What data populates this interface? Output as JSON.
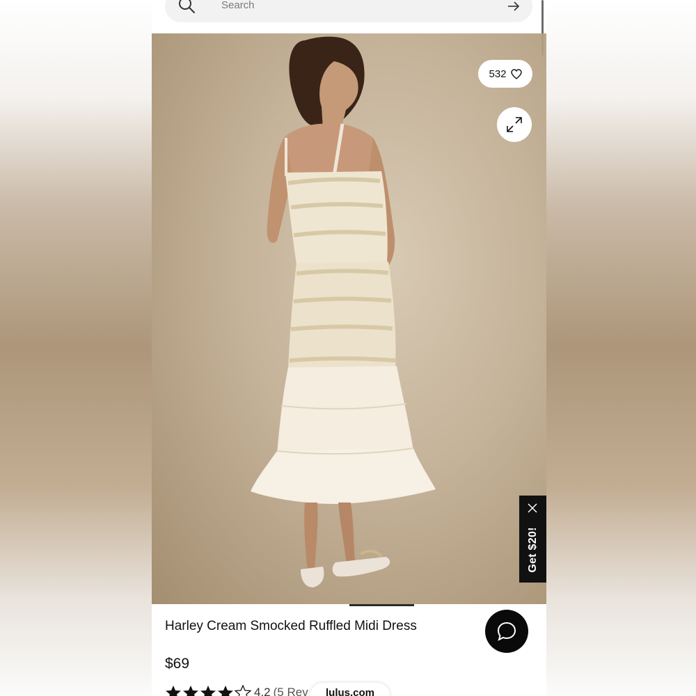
{
  "search": {
    "placeholder": "Search",
    "icon": "search-icon",
    "submit_icon": "arrow-right-icon"
  },
  "product_image": {
    "alt": "Model wearing cream smocked ruffled midi dress, back view"
  },
  "favorites": {
    "count": "532",
    "icon": "heart-icon"
  },
  "expand": {
    "icon": "expand-icon"
  },
  "promo": {
    "label": "Get $20!",
    "close_icon": "close-icon"
  },
  "product": {
    "title": "Harley Cream Smocked Ruffled Midi Dress",
    "price": "$69",
    "rating_value": "4.2",
    "rating_stars": 4.2,
    "reviews_label": "(5 Rev"
  },
  "chat": {
    "icon": "chat-bubble-icon"
  },
  "domain": "lulus.com",
  "colors": {
    "accent_dark": "#0a0a0a",
    "page_bg": "#ffffff",
    "photo_bg": "#bfa98c"
  }
}
